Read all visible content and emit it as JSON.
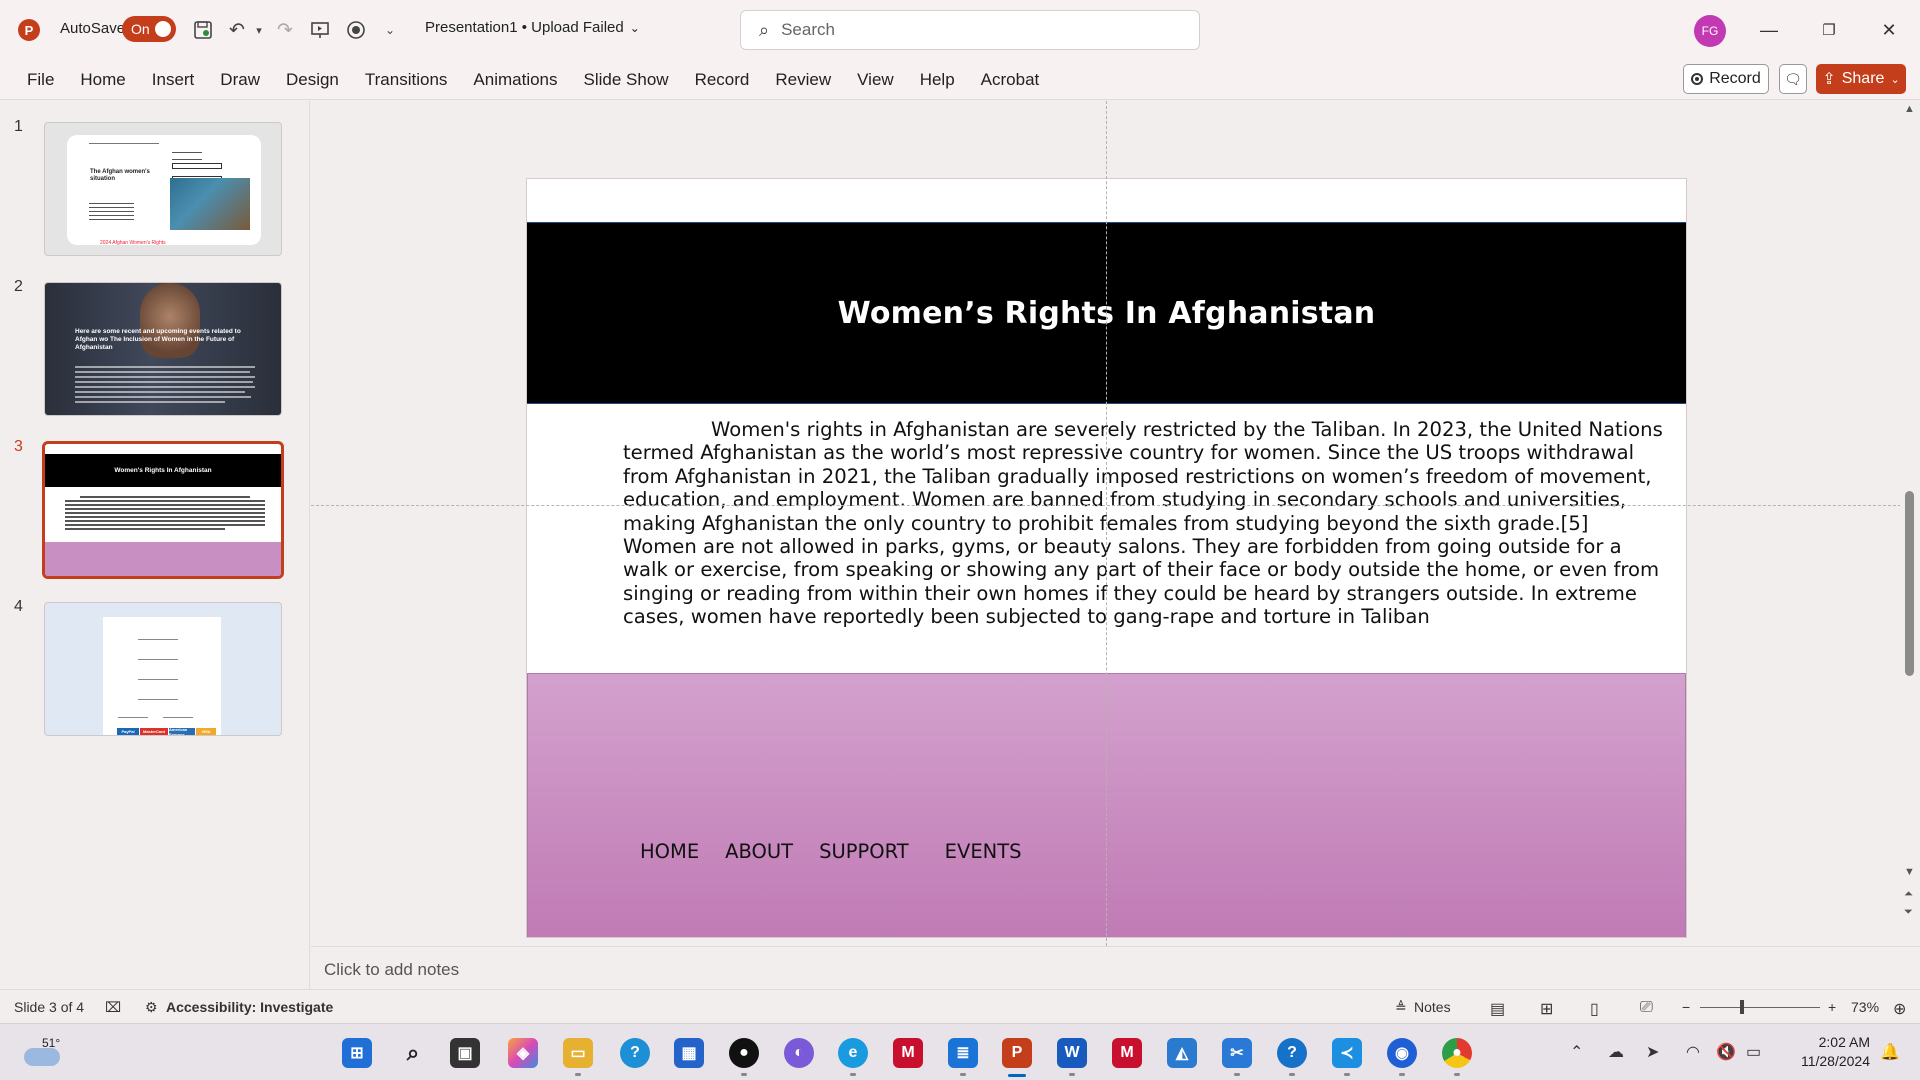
{
  "app": {
    "autosave_label": "AutoSave",
    "autosave_state": "On",
    "document_title": "Presentation1 • Upload Failed",
    "search_placeholder": "Search",
    "user_initials": "FG",
    "accent_color": "#c43e1c"
  },
  "ribbon": {
    "tabs": [
      "File",
      "Home",
      "Insert",
      "Draw",
      "Design",
      "Transitions",
      "Animations",
      "Slide Show",
      "Record",
      "Review",
      "View",
      "Help",
      "Acrobat"
    ],
    "record_label": "Record",
    "share_label": "Share"
  },
  "thumbnails": {
    "numbers": [
      "1",
      "2",
      "3",
      "4"
    ],
    "active_index": 3,
    "t1_title": "The Afghan women's situation",
    "t1_footer": "2024 Afghan Women's Rights",
    "t2_title": "Here are some recent and upcoming events related to Afghan wo The Inclusion of Women in the Future of Afghanistan",
    "t3_title": "Women's Rights In Afghanistan",
    "t4_payments": [
      "PayPal",
      "MasterCard",
      "American Express",
      "VISA"
    ]
  },
  "slide": {
    "title": "Women’s Rights In Afghanistan",
    "body": "Women's rights in Afghanistan are severely restricted by the Taliban. In 2023, the United Nations termed Afghanistan as the world’s most repressive country for women. Since the US troops withdrawal from Afghanistan in 2021, the Taliban gradually imposed restrictions on women’s freedom of movement, education, and employment. Women are banned from studying in secondary schools and universities, making Afghanistan the only country to prohibit females from studying beyond the sixth grade.[5] Women are not allowed in parks, gyms, or    beauty salons. They are forbidden from going outside for a walk or exercise, from speaking or showing any part of their face or body outside the home, or even from singing or reading from within their own homes if they could be heard by strangers outside. In extreme cases, women have reportedly been subjected to gang-rape and torture in Taliban",
    "nav": [
      "HOME",
      "ABOUT",
      "SUPPORT",
      "EVENTS"
    ]
  },
  "notes_placeholder": "Click to add notes",
  "status": {
    "slide_counter": "Slide 3 of 4",
    "accessibility": "Accessibility: Investigate",
    "notes_label": "Notes",
    "zoom": "73%"
  },
  "taskbar": {
    "temperature": "51°",
    "time": "2:02 AM",
    "date": "11/28/2024"
  }
}
